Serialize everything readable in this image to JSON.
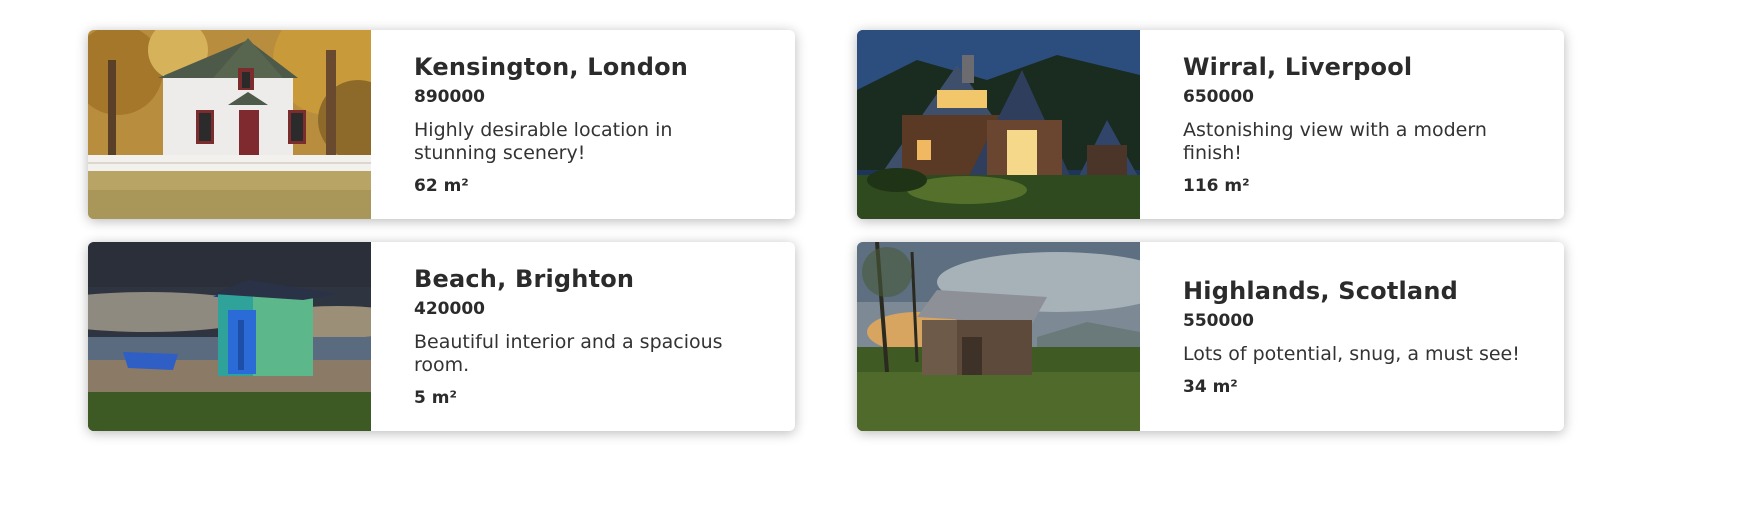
{
  "listings": [
    {
      "location": "Kensington, London",
      "price": "890000",
      "description": "Highly desirable location in stunning scenery!",
      "area": "62 m²",
      "photo_icon": "white-cottage-photo"
    },
    {
      "location": "Wirral, Liverpool",
      "price": "650000",
      "description": "Astonishing view with a modern finish!",
      "area": "116 m²",
      "photo_icon": "modern-house-night-photo"
    },
    {
      "location": "Beach, Brighton",
      "price": "420000",
      "description": "Beautiful interior and a spacious room.",
      "area": "5 m²",
      "photo_icon": "beach-hut-photo"
    },
    {
      "location": "Highlands, Scotland",
      "price": "550000",
      "description": "Lots of potential, snug, a must see!",
      "area": "34 m²",
      "photo_icon": "wooden-barn-photo"
    }
  ],
  "colors": {
    "text": "#2b2b2b",
    "card_background": "#ffffff",
    "page_background": "#ffffff"
  }
}
